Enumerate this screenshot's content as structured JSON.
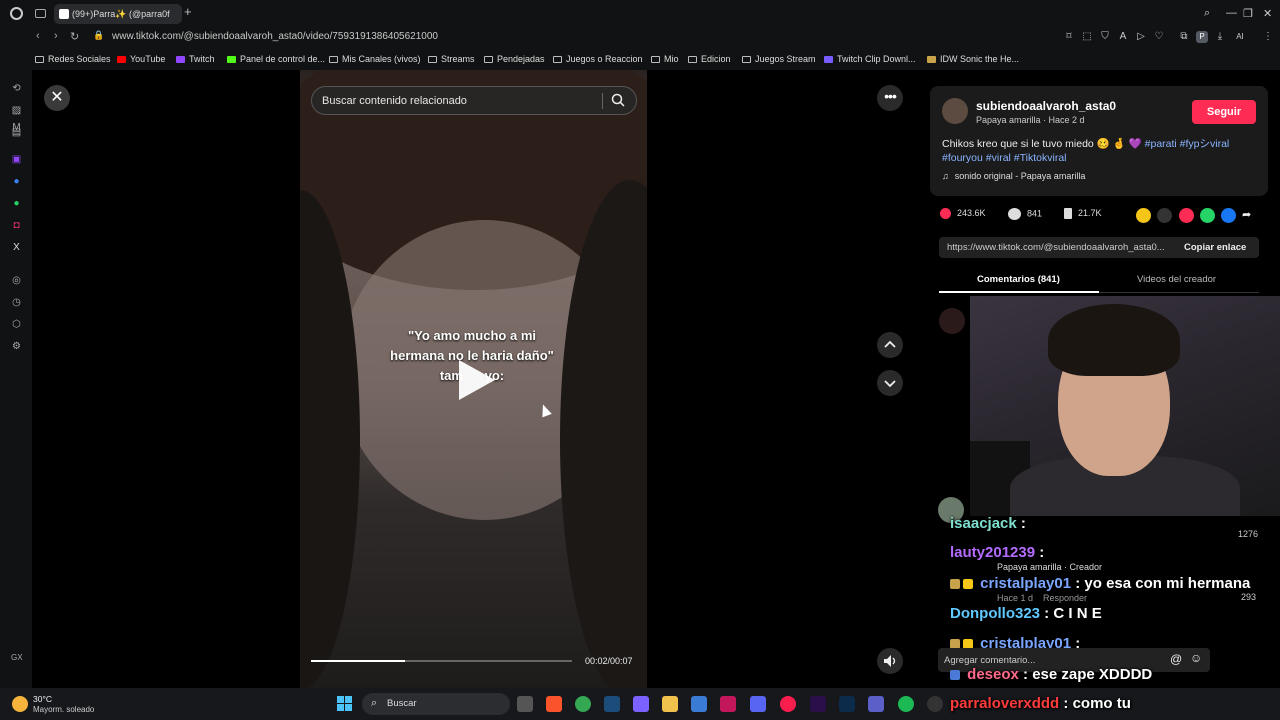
{
  "browser": {
    "tab_title": "(99+)Parra✨ (@parra0f",
    "url": "www.tiktok.com/@subiendoaalvaroh_asta0/video/7593191386405621000",
    "ext_profile": "P",
    "ext_ai": "AI"
  },
  "bookmarks": [
    "Redes Sociales",
    "YouTube",
    "Twitch",
    "Panel de control de...",
    "Mis Canales (vivos)",
    "Streams",
    "Pendejadas",
    "Juegos o Reaccion",
    "Mio",
    "Edicion",
    "Juegos Stream",
    "Twitch Clip Downl...",
    "IDW Sonic the He..."
  ],
  "video": {
    "search_placeholder": "Buscar contenido relacionado",
    "overlay_line1": "\"Yo amo mucho a mi",
    "overlay_line2": "hermana no le haria daño\"",
    "overlay_line3": "tam      yo:",
    "time": "00:02/00:07",
    "progress": 0.36
  },
  "post": {
    "username": "subiendoaalvaroh_asta0",
    "subtitle": "Papaya amarilla · Hace 2 d",
    "follow_label": "Seguir",
    "caption_text": "Chikos kreo que si le tuvo miedo 🥴 🤞 💜",
    "caption_tags_1": "#parati #fypシviral",
    "caption_tags_2": "#fouryou #viral #Tiktokviral",
    "music": "sonido original - Papaya amarilla",
    "likes": "243.6K",
    "comments": "841",
    "saves": "21.7K",
    "link": "https://www.tiktok.com/@subiendoaalvaroh_asta0...",
    "copy_label": "Copiar enlace",
    "tab_comments": "Comentarios (841)",
    "tab_videos": "Videos del creador",
    "add_comment_placeholder": "Agregar comentario...",
    "comment_author": "Papaya amarilla · Creador",
    "comment_meta": "Hace 1 d    Responder",
    "comment_count_1": "1276",
    "comment_count_2": "293"
  },
  "chat": [
    {
      "user": "isaacjack",
      "sep": " : ",
      "msg": "",
      "color": "#7fe0d0"
    },
    {
      "user": "lauty201239",
      "sep": " : ",
      "msg": "",
      "color": "#b36bff"
    },
    {
      "user": "cristalplay01",
      "sep": " : ",
      "msg": "yo esa con mi hermana",
      "color": "#7aa6ff"
    },
    {
      "user": "Donpollo323",
      "sep": " : ",
      "msg": "C I N E",
      "color": "#5ec8ff"
    },
    {
      "user": "cristalplay01",
      "sep": " : ",
      "msg": "",
      "color": "#7aa6ff"
    },
    {
      "user": "deseox",
      "sep": " : ",
      "msg": "ese zape XDDDD",
      "color": "#ff6a8a"
    },
    {
      "user": "parraloverxddd",
      "sep": " : ",
      "msg": "como tu",
      "color": "#ff3b3b"
    }
  ],
  "taskbar": {
    "temp": "30°C",
    "weather": "Mayorm. soleado",
    "search_label": "Buscar"
  },
  "sidebar_label": "GX"
}
